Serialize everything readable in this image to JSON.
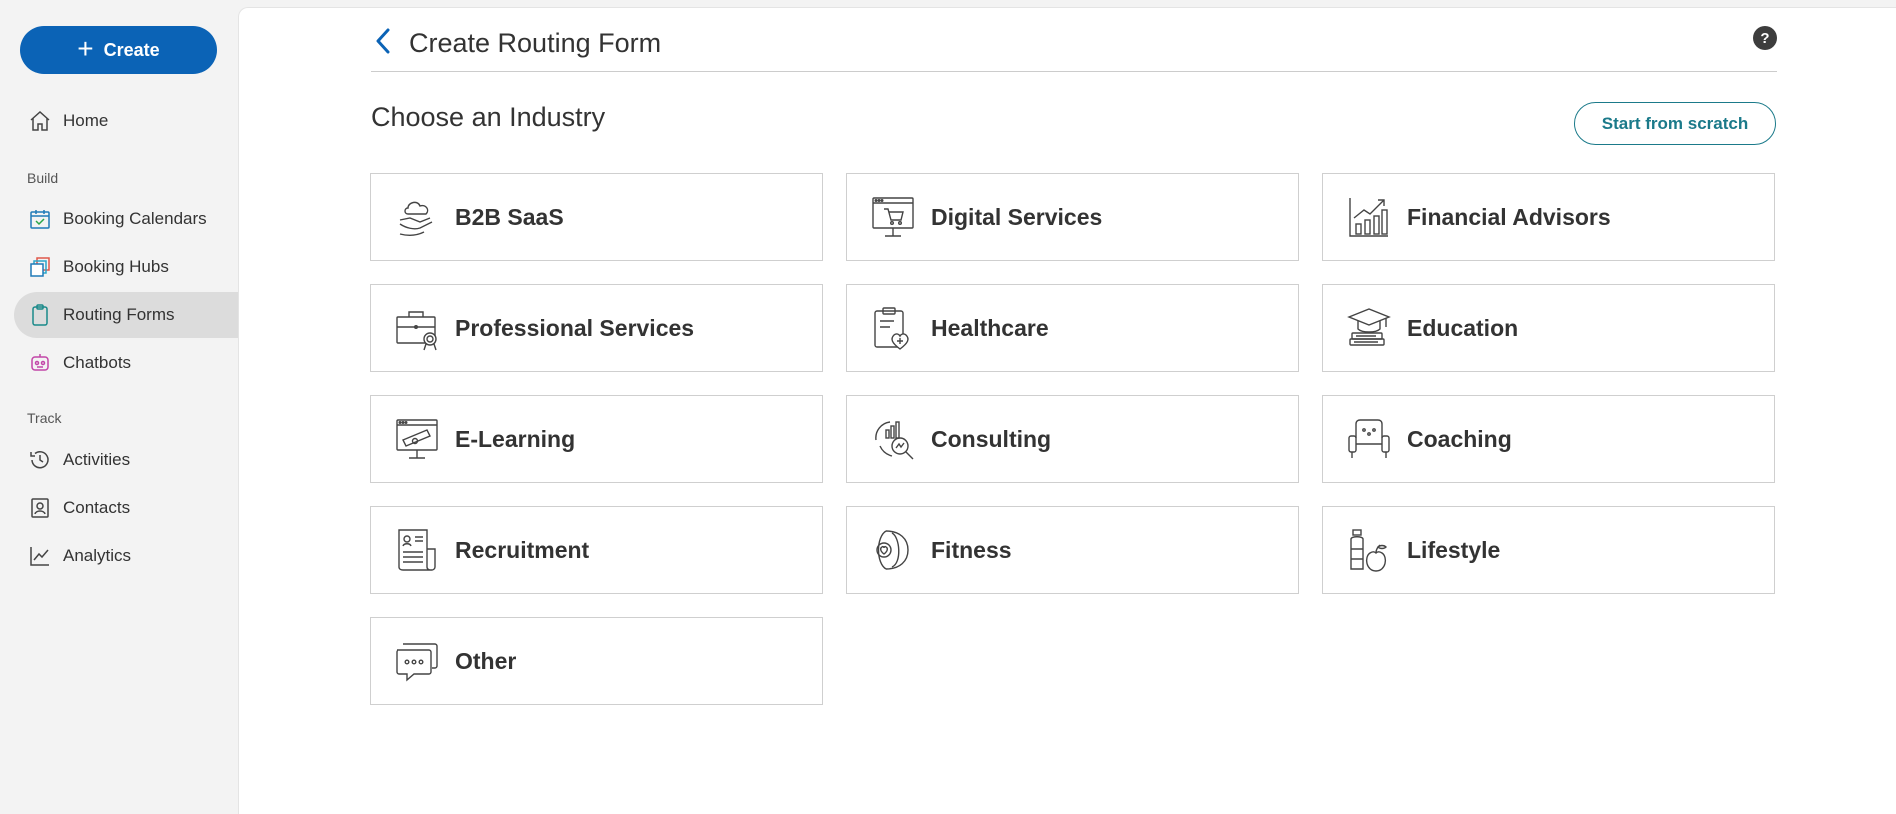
{
  "sidebar": {
    "create_label": "Create",
    "items": [
      {
        "label": "Home",
        "icon": "home-icon"
      },
      {
        "label": "Booking Calendars",
        "icon": "calendar-icon"
      },
      {
        "label": "Booking Hubs",
        "icon": "hub-icon"
      },
      {
        "label": "Routing Forms",
        "icon": "clipboard-icon",
        "active": true
      },
      {
        "label": "Chatbots",
        "icon": "bot-icon"
      },
      {
        "label": "Activities",
        "icon": "history-icon"
      },
      {
        "label": "Contacts",
        "icon": "contact-icon"
      },
      {
        "label": "Analytics",
        "icon": "chart-icon"
      }
    ],
    "sections": {
      "build": "Build",
      "track": "Track"
    }
  },
  "header": {
    "title": "Create Routing Form",
    "help": "?"
  },
  "main": {
    "section_title": "Choose an Industry",
    "scratch_label": "Start from scratch",
    "industries": [
      {
        "label": "B2B SaaS",
        "icon": "cloud-hand-icon"
      },
      {
        "label": "Digital Services",
        "icon": "monitor-cart-icon"
      },
      {
        "label": "Financial Advisors",
        "icon": "growth-chart-icon"
      },
      {
        "label": "Professional Services",
        "icon": "briefcase-badge-icon"
      },
      {
        "label": "Healthcare",
        "icon": "clipboard-heart-icon"
      },
      {
        "label": "Education",
        "icon": "graduation-books-icon"
      },
      {
        "label": "E-Learning",
        "icon": "monitor-telescope-icon"
      },
      {
        "label": "Consulting",
        "icon": "magnifier-chart-icon"
      },
      {
        "label": "Coaching",
        "icon": "armchair-icon"
      },
      {
        "label": "Recruitment",
        "icon": "resume-icon"
      },
      {
        "label": "Fitness",
        "icon": "fitness-band-icon"
      },
      {
        "label": "Lifestyle",
        "icon": "bottle-apple-icon"
      },
      {
        "label": "Other",
        "icon": "chat-bubbles-icon"
      }
    ]
  },
  "colors": {
    "accent": "#0b63b6",
    "teal": "#1b7a8a",
    "active_nav": "#dcdcdc"
  }
}
